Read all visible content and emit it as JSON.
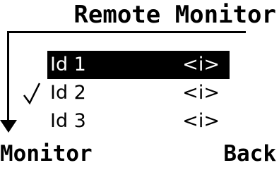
{
  "title": "Remote Monitor",
  "items": [
    {
      "label": "Id 1",
      "info": "<i>",
      "selected": true,
      "checked": false
    },
    {
      "label": "Id 2",
      "info": "<i>",
      "selected": false,
      "checked": true
    },
    {
      "label": "Id 3",
      "info": "<i>",
      "selected": false,
      "checked": false
    }
  ],
  "softkeys": {
    "left": "Monitor",
    "right": "Back"
  }
}
